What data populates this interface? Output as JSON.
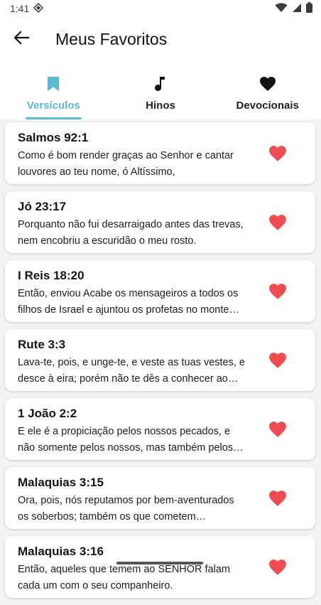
{
  "status": {
    "time": "1:41"
  },
  "header": {
    "title": "Meus Favoritos"
  },
  "tabs": [
    {
      "label": "Versículos",
      "icon": "bookmark-icon"
    },
    {
      "label": "Hinos",
      "icon": "music-note-icon"
    },
    {
      "label": "Devocionais",
      "icon": "heart-icon"
    }
  ],
  "colors": {
    "accent": "#5db9cf",
    "heart": "#ef4b52"
  },
  "favorites": [
    {
      "ref": "Salmos 92:1",
      "text": "Como é bom render graças ao Senhor e cantar louvores ao teu nome, ó Altíssimo,"
    },
    {
      "ref": "Jó 23:17",
      "text": "Porquanto não fui desarraigado antes das trevas, nem encobriu a escuridão o meu rosto."
    },
    {
      "ref": "I Reis 18:20",
      "text": "Então, enviou Acabe os mensageiros a todos os filhos de Israel e ajuntou os profetas no monte Carmelo."
    },
    {
      "ref": "Rute 3:3",
      "text": "Lava-te, pois, e unge-te, e veste as tuas vestes, e desce à eira; porém não te dês a conhecer ao homem."
    },
    {
      "ref": "1 João 2:2",
      "text": "E ele é a propiciação pelos nossos pecados, e não somente pelos nossos, mas também pelos de todo o mundo."
    },
    {
      "ref": "Malaquias 3:15",
      "text": "Ora, pois, nós reputamos por bem-aventurados os soberbos; também os que cometem impiedade."
    },
    {
      "ref": "Malaquias 3:16",
      "text": "Então, aqueles que temem ao SENHOR falam cada um com o seu companheiro."
    }
  ]
}
